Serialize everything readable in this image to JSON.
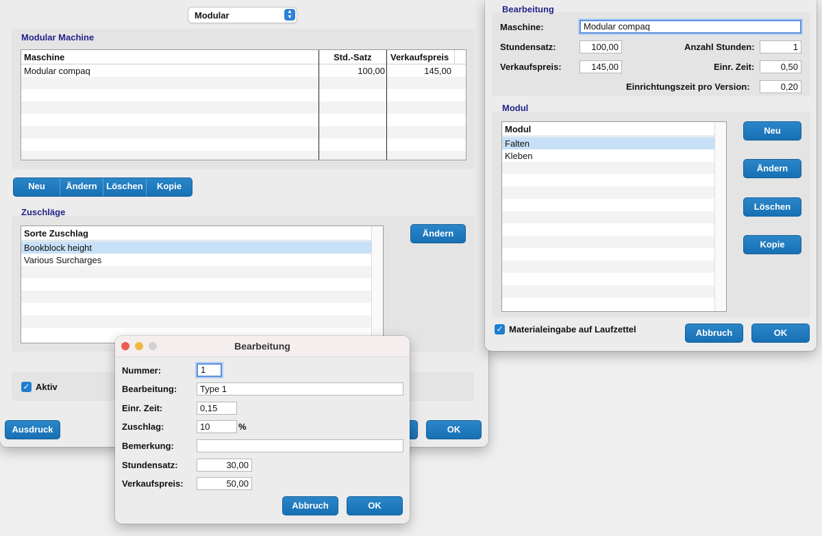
{
  "main_window": {
    "type_select": "Modular",
    "machine_section_title": "Modular Machine",
    "machine_table": {
      "headers": [
        "Maschine",
        "Std.-Satz",
        "Verkaufspreis"
      ],
      "rows": [
        {
          "name": "Modular compaq",
          "rate": "100,00",
          "price": "145,00"
        }
      ]
    },
    "buttons": {
      "new": "Neu",
      "edit": "Ändern",
      "delete": "Löschen",
      "copy": "Kopie"
    },
    "surcharge_section_title": "Zuschläge",
    "surcharge_table": {
      "header": "Sorte Zuschlag",
      "rows": [
        "Bookblock height",
        "Various Surcharges"
      ]
    },
    "surcharge_edit_button": "Ändern",
    "active_label": "Aktiv",
    "print_button": "Ausdruck",
    "ok_button": "OK"
  },
  "right_window": {
    "title": "Bearbeitung",
    "machine_label": "Maschine:",
    "machine_value": "Modular compaq",
    "hourly_rate_label": "Stundensatz:",
    "hourly_rate_value": "100,00",
    "hours_label": "Anzahl Stunden:",
    "hours_value": "1",
    "sale_price_label": "Verkaufspreis:",
    "sale_price_value": "145,00",
    "setup_time_label": "Einr. Zeit:",
    "setup_time_value": "0,50",
    "setup_per_version_label": "Einrichtungszeit pro Version:",
    "setup_per_version_value": "0,20",
    "module_section_title": "Modul",
    "module_table": {
      "header": "Modul",
      "rows": [
        "Falten",
        "Kleben"
      ]
    },
    "buttons": {
      "new": "Neu",
      "edit": "Ändern",
      "delete": "Löschen",
      "copy": "Kopie"
    },
    "material_checkbox_label": "Materialeingabe auf Laufzettel",
    "cancel_button": "Abbruch",
    "ok_button": "OK"
  },
  "dialog": {
    "title": "Bearbeitung",
    "number_label": "Nummer:",
    "number_value": "1",
    "processing_label": "Bearbeitung:",
    "processing_value": "Type 1",
    "setup_time_label": "Einr. Zeit:",
    "setup_time_value": "0,15",
    "surcharge_label": "Zuschlag:",
    "surcharge_value": "10",
    "surcharge_unit": "%",
    "remark_label": "Bemerkung:",
    "remark_value": "",
    "hourly_rate_label": "Stundensatz:",
    "hourly_rate_value": "30,00",
    "sale_price_label": "Verkaufspreis:",
    "sale_price_value": "50,00",
    "cancel_button": "Abbruch",
    "ok_button": "OK"
  },
  "colors": {
    "accent": "#1d77bd",
    "section_title": "#23238a",
    "selection": "#c8e0f7"
  }
}
